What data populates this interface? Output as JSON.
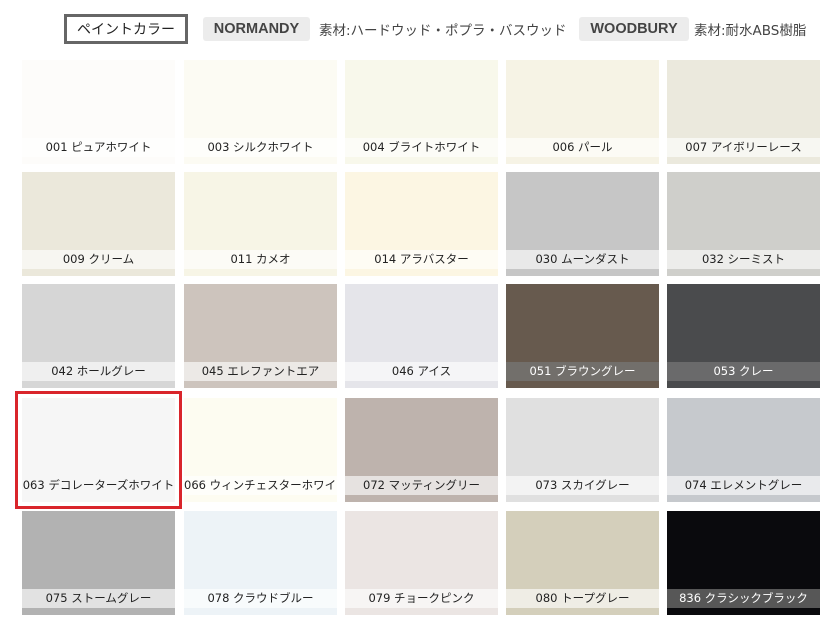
{
  "header": {
    "paint_tab_label": "ペイントカラー",
    "normandy_label": "NORMANDY",
    "normandy_material": "素材:ハードウッド・ポプラ・バスウッド",
    "woodbury_label": "WOODBURY",
    "woodbury_material": "素材:耐水ABS樹脂"
  },
  "swatches": [
    {
      "label": "001 ピュアホワイト",
      "color": "#fdfcfa"
    },
    {
      "label": "003 シルクホワイト",
      "color": "#fcfbf3"
    },
    {
      "label": "004 ブライトホワイト",
      "color": "#f8f8eb"
    },
    {
      "label": "006 パール",
      "color": "#f6f3e5"
    },
    {
      "label": "007 アイボリーレース",
      "color": "#ebe9dd"
    },
    {
      "label": "009 クリーム",
      "color": "#ebe8db"
    },
    {
      "label": "011 カメオ",
      "color": "#f7f5e6"
    },
    {
      "label": "014 アラバスター",
      "color": "#fcf6e3"
    },
    {
      "label": "030 ムーンダスト",
      "color": "#c6c6c6"
    },
    {
      "label": "032 シーミスト",
      "color": "#cfcfcb"
    },
    {
      "label": "042 ホールグレー",
      "color": "#d6d6d6"
    },
    {
      "label": "045 エレファントエア",
      "color": "#cdc4bd"
    },
    {
      "label": "046 アイス",
      "color": "#e5e5ea"
    },
    {
      "label": "051 ブラウングレー",
      "color": "#675a4e"
    },
    {
      "label": "053 クレー",
      "color": "#4a4b4d"
    },
    {
      "label": "063 デコレーターズホワイト",
      "color": "#f6f6f6"
    },
    {
      "label": "066 ウィンチェスターホワイト",
      "color": "#fdfcf1"
    },
    {
      "label": "072 マッティングリー",
      "color": "#beb3ad"
    },
    {
      "label": "073 スカイグレー",
      "color": "#e0e0e0"
    },
    {
      "label": "074 エレメントグレー",
      "color": "#c6c9cd"
    },
    {
      "label": "075 ストームグレー",
      "color": "#b2b2b2"
    },
    {
      "label": "078 クラウドブルー",
      "color": "#edf3f7"
    },
    {
      "label": "079 チョークピンク",
      "color": "#ebe5e3"
    },
    {
      "label": "080 トープグレー",
      "color": "#d4cfbb"
    },
    {
      "label": "836 クラシックブラック",
      "color": "#0a0a0d"
    }
  ],
  "selected_swatch_color": "#d9252b"
}
